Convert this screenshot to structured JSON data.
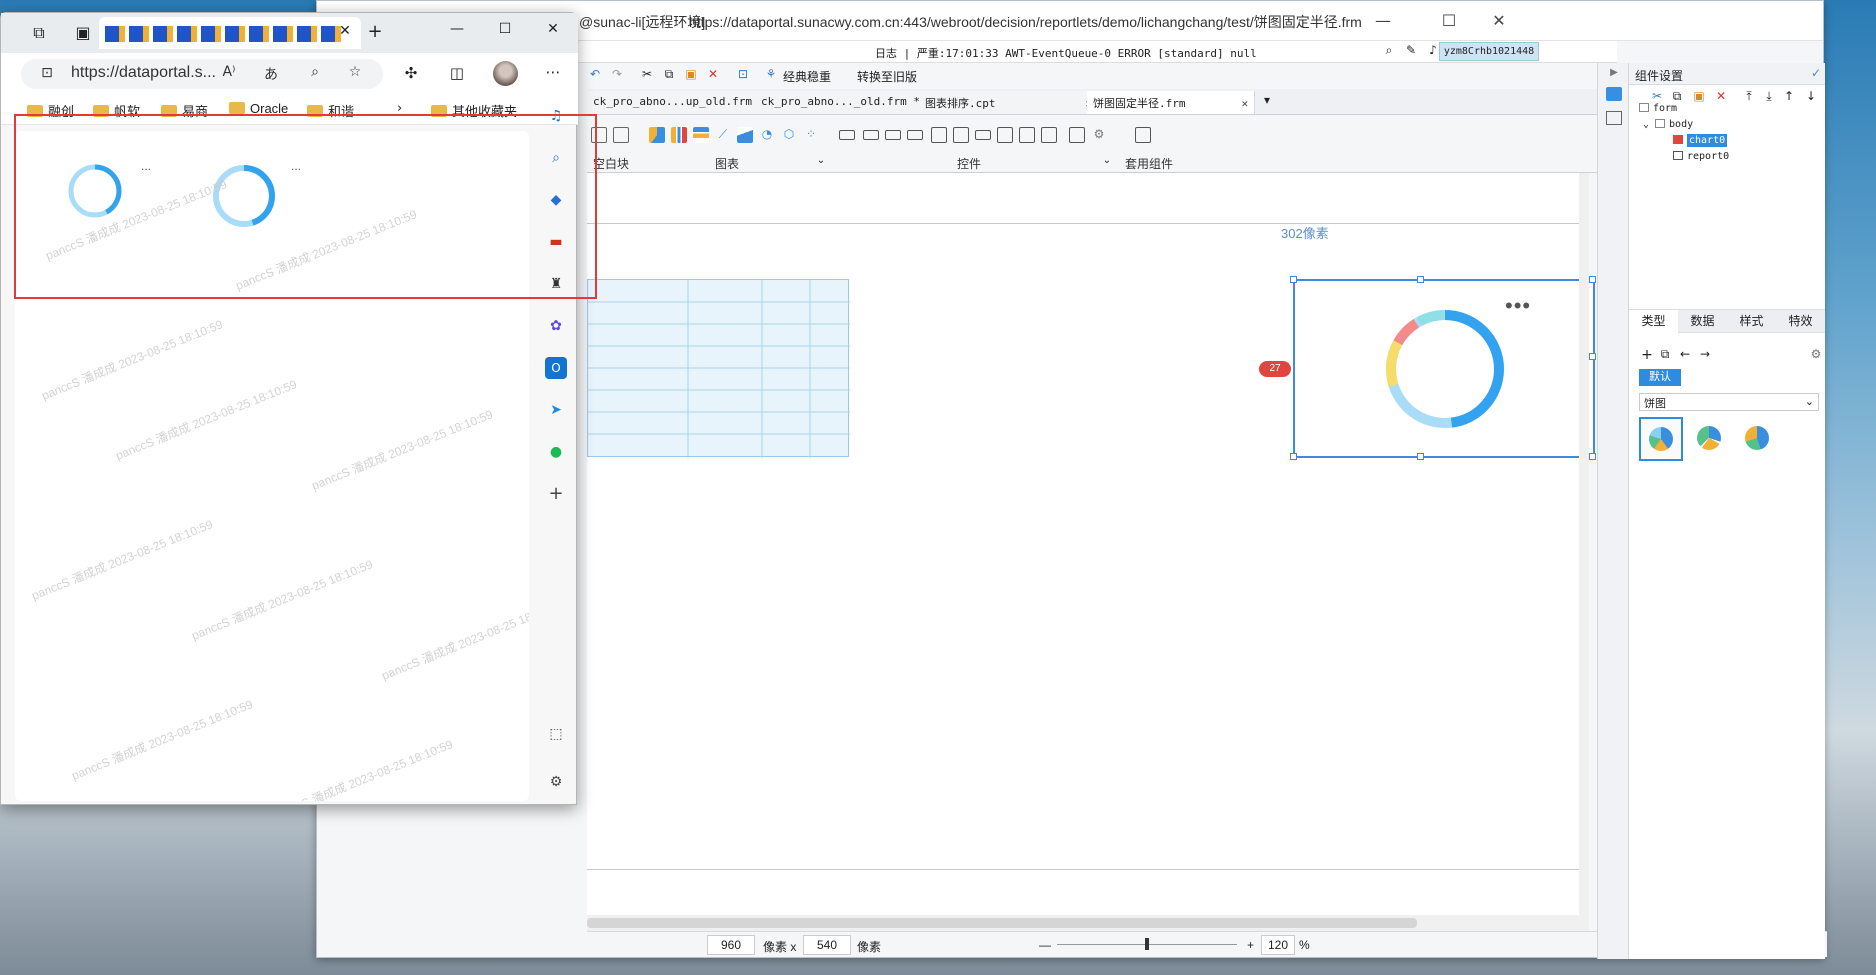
{
  "designer": {
    "window_title": "https://dataportal.sunacwy.com.cn:443/webroot/decision/reportlets/demo/lichangchang/test/饼图固定半径.frm",
    "title_prefix": "@sunac-li[远程环境]",
    "status_log": "日志 | 严重:17:01:33 AWT-EventQueue-0 ERROR [standard] null",
    "user": "yzm8Crhb1021448",
    "toolbar_buttons": [
      "经典稳重",
      "转换至旧版"
    ],
    "doc_tabs": [
      {
        "label": "ck_pro_abno...up_old.frm",
        "active": false
      },
      {
        "label": "ck_pro_abno..._old.frm *",
        "active": false
      },
      {
        "label": "图表排序.cpt",
        "active": false
      },
      {
        "label": "饼图固定半径.frm",
        "active": true
      }
    ],
    "ribbon_groups": [
      "空白块",
      "图表",
      "控件",
      "套用组件"
    ],
    "canvas_note": "302像素",
    "badge": "27",
    "bottom": {
      "width": "960",
      "width_unit": "像素 x",
      "height": "540",
      "height_unit": "像素",
      "zoom": "120",
      "zoom_unit": "%"
    },
    "right_panel": {
      "title": "组件设置",
      "tree": [
        "form",
        "body",
        "chart0",
        "report0"
      ],
      "tabs": [
        "类型",
        "数据",
        "样式",
        "特效"
      ],
      "default_label": "默认",
      "chart_type": "饼图"
    },
    "donut_colors": {
      "main": "#33a3f0",
      "light": "#a9dcf6",
      "red": "#f48a8a",
      "yellow": "#f7dc6a",
      "teal": "#8ee0e6"
    }
  },
  "browser": {
    "url": "https://dataportal.s...",
    "favorites": [
      "融创",
      "帆软",
      "易商",
      "Oracle",
      "和谐",
      "其他收藏夹"
    ],
    "more_label": "...",
    "watermark_text": "panccS 潘成成 2023-08-25 18:10:59"
  }
}
